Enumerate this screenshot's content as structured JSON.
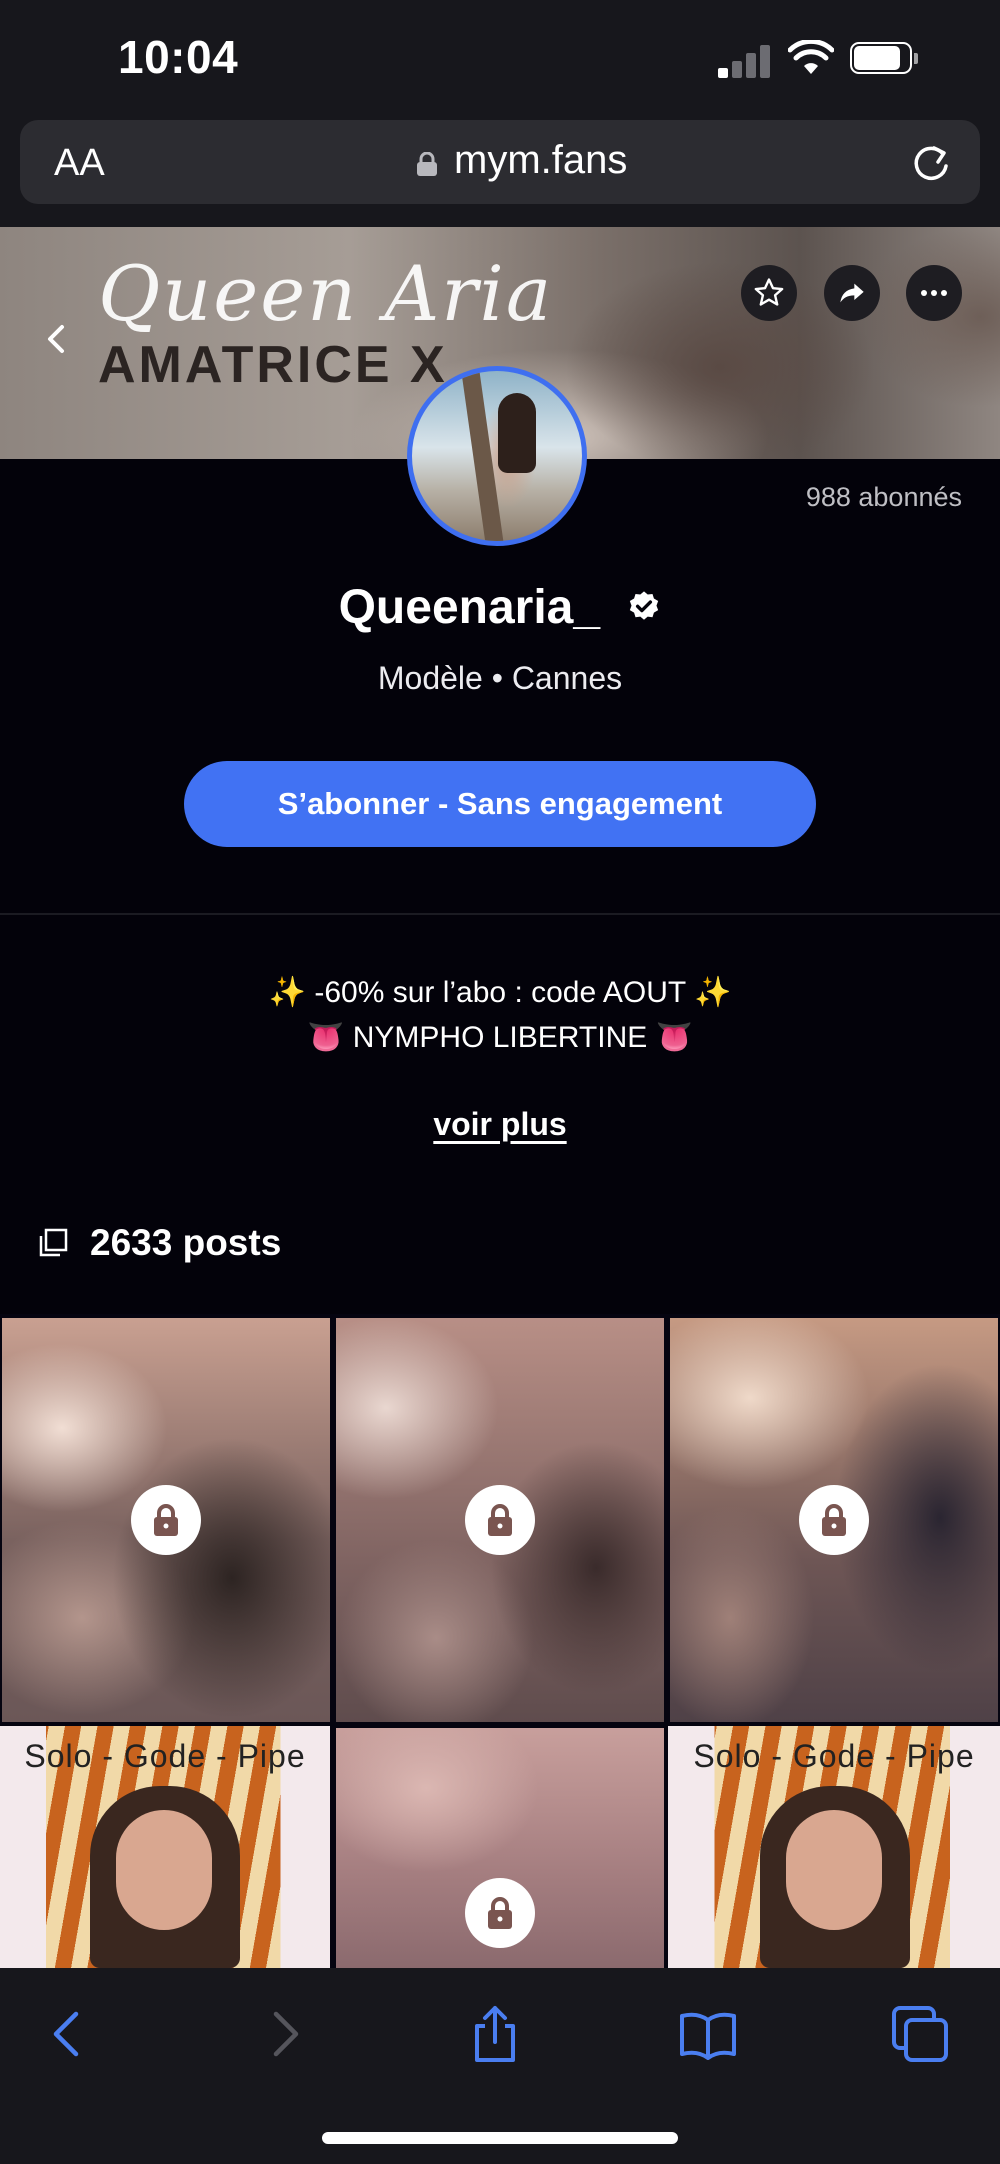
{
  "status_bar": {
    "time": "10:04"
  },
  "url_bar": {
    "text_size_label": "AA",
    "url": "mym.fans"
  },
  "banner": {
    "script_text": "Queen Aria",
    "brand_text": "AMATRICE X"
  },
  "profile": {
    "subscribers": "988 abonnés",
    "name": "Queenaria_",
    "subtitle": "Modèle • Cannes",
    "subscribe_label": "S’abonner - Sans engagement",
    "bio_line1": "✨ -60% sur l’abo : code AOUT ✨",
    "bio_line2": "👅 NYMPHO LIBERTINE 👅",
    "see_more": "voir plus"
  },
  "posts": {
    "count_label": "2633 posts",
    "tiles": [
      {
        "locked": true,
        "caption": ""
      },
      {
        "locked": true,
        "caption": ""
      },
      {
        "locked": true,
        "caption": ""
      },
      {
        "locked": false,
        "caption": "Solo - Gode - Pipe"
      },
      {
        "locked": true,
        "caption": ""
      },
      {
        "locked": false,
        "caption": "Solo - Gode - Pipe"
      }
    ]
  },
  "colors": {
    "accent": "#4172f3",
    "background": "#03020a",
    "chrome": "#17171c"
  },
  "icons": [
    "back-icon",
    "star-icon",
    "share-icon",
    "more-icon",
    "verified-icon",
    "lock-icon",
    "posts-icon",
    "reload-icon",
    "safari-back-icon",
    "safari-forward-icon",
    "share-sheet-icon",
    "bookmarks-icon",
    "tabs-icon"
  ]
}
